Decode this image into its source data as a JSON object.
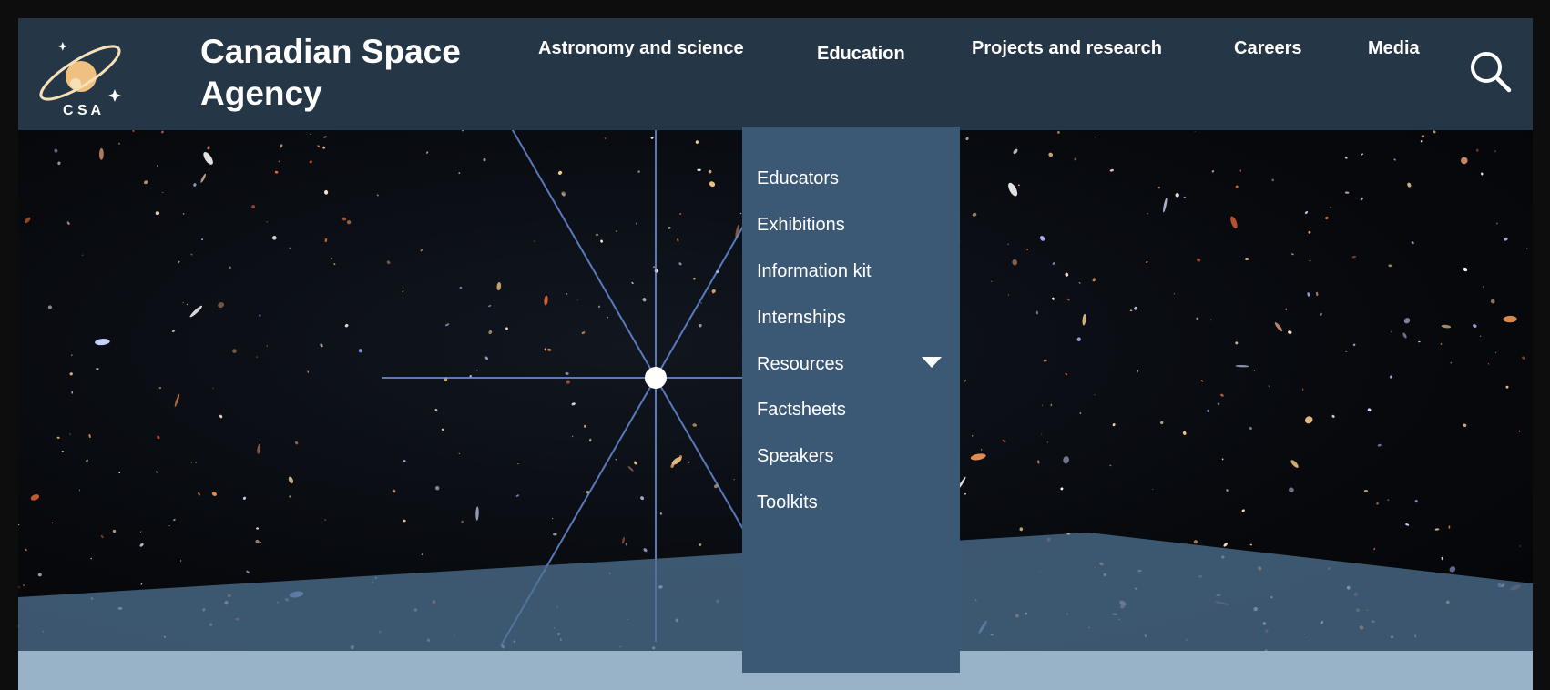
{
  "header": {
    "logo_text": "C S A",
    "title": "Canadian Space Agency"
  },
  "nav": {
    "items": [
      {
        "label": "Astronomy and science"
      },
      {
        "label": "Education"
      },
      {
        "label": "Projects and research"
      },
      {
        "label": "Careers"
      },
      {
        "label": "Media"
      }
    ],
    "search_icon": "search-icon"
  },
  "dropdown": {
    "items": [
      {
        "label": "Educators"
      },
      {
        "label": "Exhibitions"
      },
      {
        "label": "Information kit"
      },
      {
        "label": "Internships"
      },
      {
        "label": "Resources"
      },
      {
        "label": "Factsheets"
      },
      {
        "label": "Speakers"
      },
      {
        "label": "Toolkits"
      }
    ],
    "caret_icon": "caret-down-icon"
  },
  "colors": {
    "header_bg": "#253646",
    "dropdown_bg": "#3b5875",
    "band_bg": "#98b3c8",
    "logo_planet": "#f0c080"
  }
}
